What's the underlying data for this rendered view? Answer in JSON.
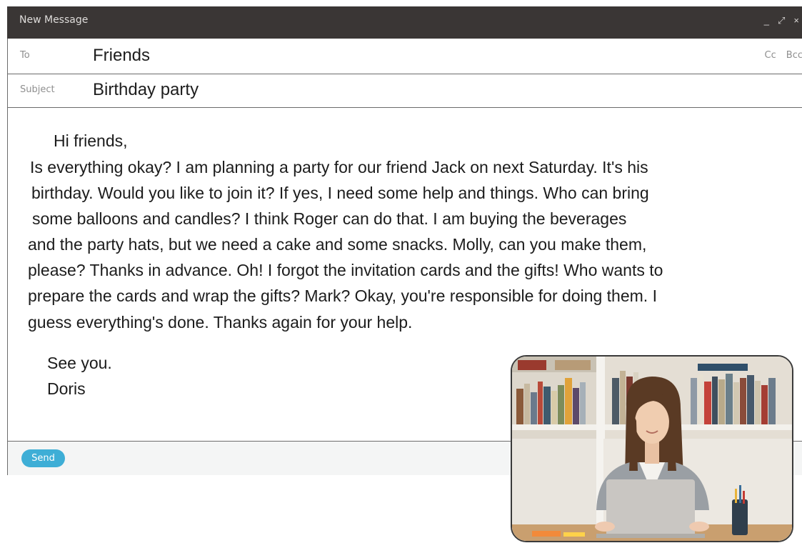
{
  "window": {
    "title": "New Message",
    "controls": {
      "minimize": "_",
      "expand": "⤢",
      "close": "×"
    }
  },
  "to": {
    "label": "To",
    "value": "Friends",
    "cc": "Cc",
    "bcc": "Bcc"
  },
  "subject": {
    "label": "Subject",
    "value": "Birthday party"
  },
  "body": {
    "greeting": "Hi friends,",
    "lines": [
      "Is everything okay? I am planning a party for our friend Jack on next Saturday. It's his",
      "birthday. Would you like to join it? If yes, I need some help and things. Who can bring",
      "some balloons and candles? I think Roger can do that. I am buying the beverages",
      "and the party hats, but we need a cake and some snacks. Molly, can you make them,",
      "please? Thanks in advance. Oh! I forgot the invitation cards and the gifts! Who wants to",
      "prepare the cards and wrap the gifts? Mark? Okay, you're responsible for doing them. I",
      "guess everything's done. Thanks again for your help."
    ],
    "closing": "See you.",
    "signature": "Doris"
  },
  "footer": {
    "send_label": "Send"
  },
  "colors": {
    "titlebar": "#3a3635",
    "send": "#3eaed6"
  }
}
